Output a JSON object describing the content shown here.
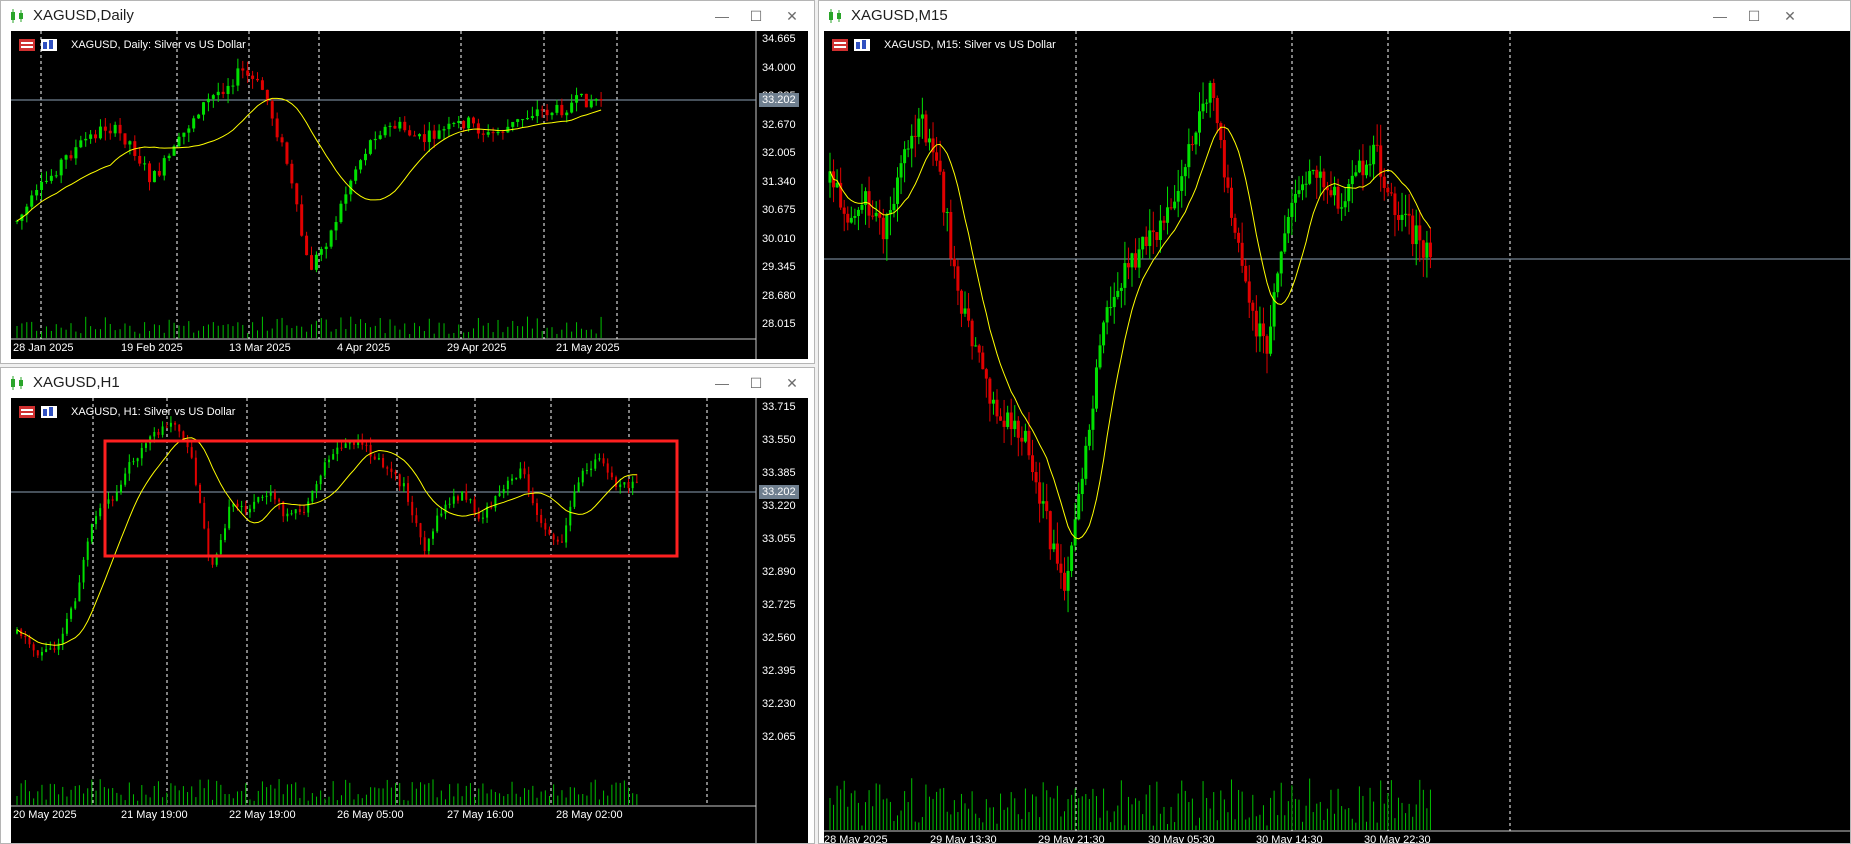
{
  "windows": {
    "daily": {
      "title": "XAGUSD,Daily",
      "label": "XAGUSD, Daily:  Silver vs US Dollar",
      "price_ticks": [
        "34.665",
        "34.000",
        "33.335",
        "32.670",
        "32.005",
        "31.340",
        "30.675",
        "30.010",
        "29.345",
        "28.680",
        "28.015"
      ],
      "time_ticks": [
        "28 Jan 2025",
        "19 Feb 2025",
        "13 Mar 2025",
        "4 Apr 2025",
        "29 Apr 2025",
        "21 May 2025"
      ],
      "current_price": "33.202"
    },
    "h1": {
      "title": "XAGUSD,H1",
      "label": "XAGUSD, H1:  Silver vs US Dollar",
      "price_ticks": [
        "33.715",
        "33.550",
        "33.385",
        "33.220",
        "33.055",
        "32.890",
        "32.725",
        "32.560",
        "32.395",
        "32.230",
        "32.065"
      ],
      "time_ticks": [
        "20 May 2025",
        "21 May 19:00",
        "22 May 19:00",
        "26 May 05:00",
        "27 May 16:00",
        "28 May 02:00"
      ],
      "current_price": "33.202"
    },
    "m15": {
      "title": "XAGUSD,M15",
      "label": "XAGUSD, M15:  Silver vs US Dollar",
      "time_ticks": [
        "28 May 2025",
        "29 May 13:30",
        "29 May 21:30",
        "30 May 05:30",
        "30 May 14:30",
        "30 May 22:30"
      ]
    }
  },
  "controls": {
    "minimize": "—",
    "maximize": "☐",
    "close": "✕"
  },
  "colors": {
    "bull": "#00e000",
    "bear": "#e00000",
    "ma": "#ffff00",
    "volume": "#00c000",
    "box": "#ff2020",
    "hline": "#8ca0b4"
  }
}
